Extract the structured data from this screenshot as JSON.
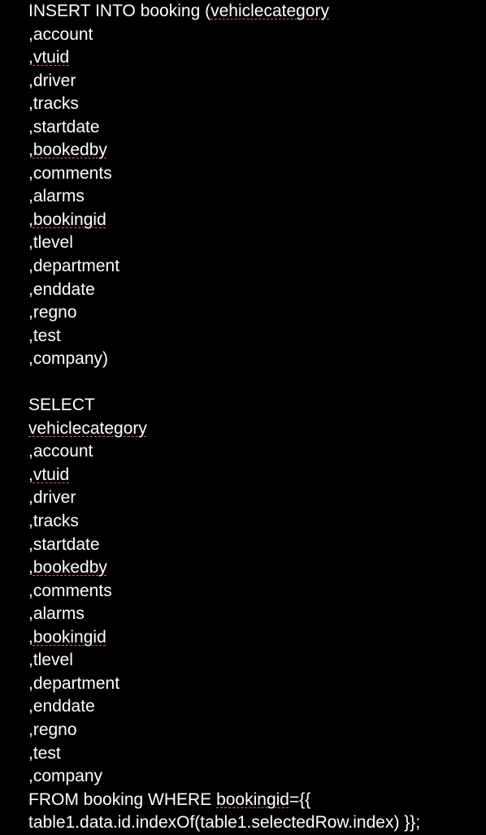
{
  "sql": {
    "insert_into": "INSERT INTO booking (",
    "col_vehiclecategory": "vehiclecategory",
    "col_account": ",account",
    "comma": ",",
    "col_vtuid": "vtuid",
    "col_driver": ",driver",
    "col_tracks": ",tracks",
    "col_startdate": ",startdate",
    "col_bookedby": "bookedby",
    "col_comments": ",comments",
    "col_alarms": ",alarms",
    "col_bookingid": "bookingid",
    "col_tlevel": ",tlevel",
    "col_department": ",department",
    "col_enddate": ",enddate",
    "col_regno": ",regno",
    "col_test": ",test",
    "col_company_insert": ",company)",
    "blank": "",
    "select": "SELECT",
    "sel_vehiclecategory": "vehiclecategory",
    "sel_account": ",account",
    "sel_vtuid": "vtuid",
    "sel_driver": ",driver",
    "sel_tracks": ",tracks",
    "sel_startdate": ",startdate",
    "sel_bookedby": "bookedby",
    "sel_comments": ",comments",
    "sel_alarms": ",alarms",
    "sel_bookingid": "bookingid",
    "sel_tlevel": ",tlevel",
    "sel_department": ",department",
    "sel_enddate": ",enddate",
    "sel_regno": ",regno",
    "sel_test": ",test",
    "sel_company": ",company",
    "from_where_pre": "FROM booking WHERE ",
    "from_where_bookingid": "bookingid",
    "from_where_post": "={{",
    "last_line": "table1.data.id.indexOf(table1.selectedRow.index) }};"
  }
}
